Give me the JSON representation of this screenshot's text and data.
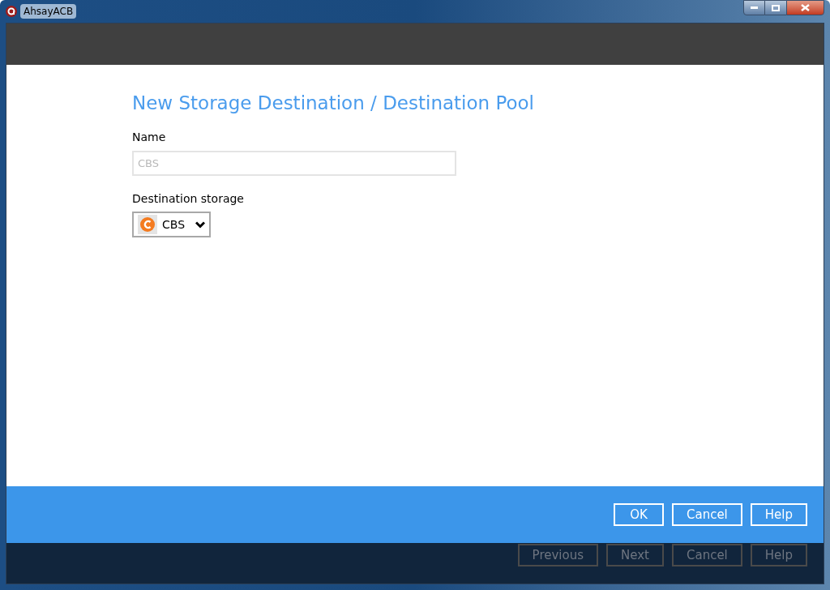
{
  "window": {
    "title": "AhsayACB"
  },
  "dialog": {
    "heading": "New Storage Destination / Destination Pool",
    "name_field": {
      "label": "Name",
      "placeholder": "CBS"
    },
    "destination_storage": {
      "label": "Destination storage",
      "value": "CBS"
    },
    "buttons": [
      {
        "label": "OK",
        "disabled": false
      },
      {
        "label": "Cancel",
        "disabled": false
      },
      {
        "label": "Help",
        "disabled": false
      }
    ]
  },
  "wizard_buttons": [
    {
      "label": "Previous",
      "disabled": true
    },
    {
      "label": "Next",
      "disabled": true
    },
    {
      "label": "Cancel",
      "disabled": true
    },
    {
      "label": "Help",
      "disabled": true
    }
  ]
}
